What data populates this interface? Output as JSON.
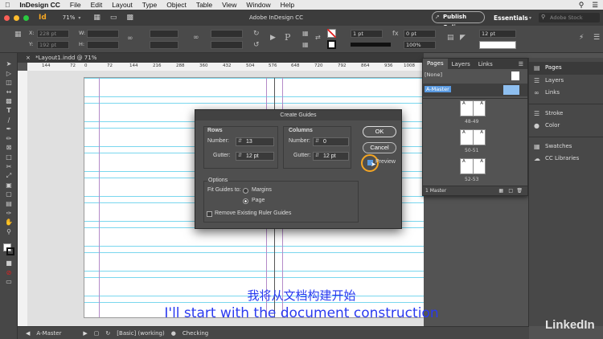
{
  "menubar": {
    "app": "InDesign CC",
    "items": [
      "File",
      "Edit",
      "Layout",
      "Type",
      "Object",
      "Table",
      "View",
      "Window",
      "Help"
    ]
  },
  "appbar": {
    "title": "Adobe InDesign CC",
    "zoom": "71%",
    "publish_label": "Publish Online",
    "workspace": "Essentials",
    "search_placeholder": "Adobe Stock"
  },
  "control": {
    "x_value": "228 pt",
    "y_value": "192 pt",
    "w_label": "W:",
    "h_label": "H:",
    "stroke_weight": "1 pt",
    "gutter": "12 pt",
    "opacity": "100%",
    "tracking": "0 pt"
  },
  "doc_tab": "*Layout1.indd @ 71%",
  "ruler_ticks": [
    "144",
    "72",
    "0",
    "72",
    "144",
    "216",
    "288",
    "360",
    "432",
    "504",
    "576",
    "648",
    "720",
    "792",
    "864",
    "936",
    "1008"
  ],
  "pages_panel": {
    "tabs": [
      "Pages",
      "Layers",
      "Links"
    ],
    "none_label": "[None]",
    "master_label": "A-Master",
    "spreads": [
      "48-49",
      "50-51",
      "52-53"
    ],
    "footer": "1 Master",
    "page_letter": "A"
  },
  "right_panel": {
    "items": [
      "Pages",
      "Layers",
      "Links",
      "Stroke",
      "Color",
      "Swatches",
      "CC Libraries"
    ]
  },
  "dialog": {
    "title": "Create Guides",
    "rows_label": "Rows",
    "columns_label": "Columns",
    "number_label": "Number:",
    "gutter_label": "Gutter:",
    "rows_number": "13",
    "rows_gutter": "12 pt",
    "cols_number": "0",
    "cols_gutter": "12 pt",
    "ok_label": "OK",
    "cancel_label": "Cancel",
    "preview_label": "Preview",
    "options_label": "Options",
    "fit_label": "Fit Guides to:",
    "margins_label": "Margins",
    "page_label": "Page",
    "remove_label": "Remove Existing Ruler Guides"
  },
  "status": {
    "page": "A-Master",
    "style": "[Basic] (working)",
    "preflight": "Checking"
  },
  "subtitle": {
    "cn": "我将从文档构建开始",
    "en": "I'll start with the document construction"
  },
  "watermark": "LinkedIn"
}
